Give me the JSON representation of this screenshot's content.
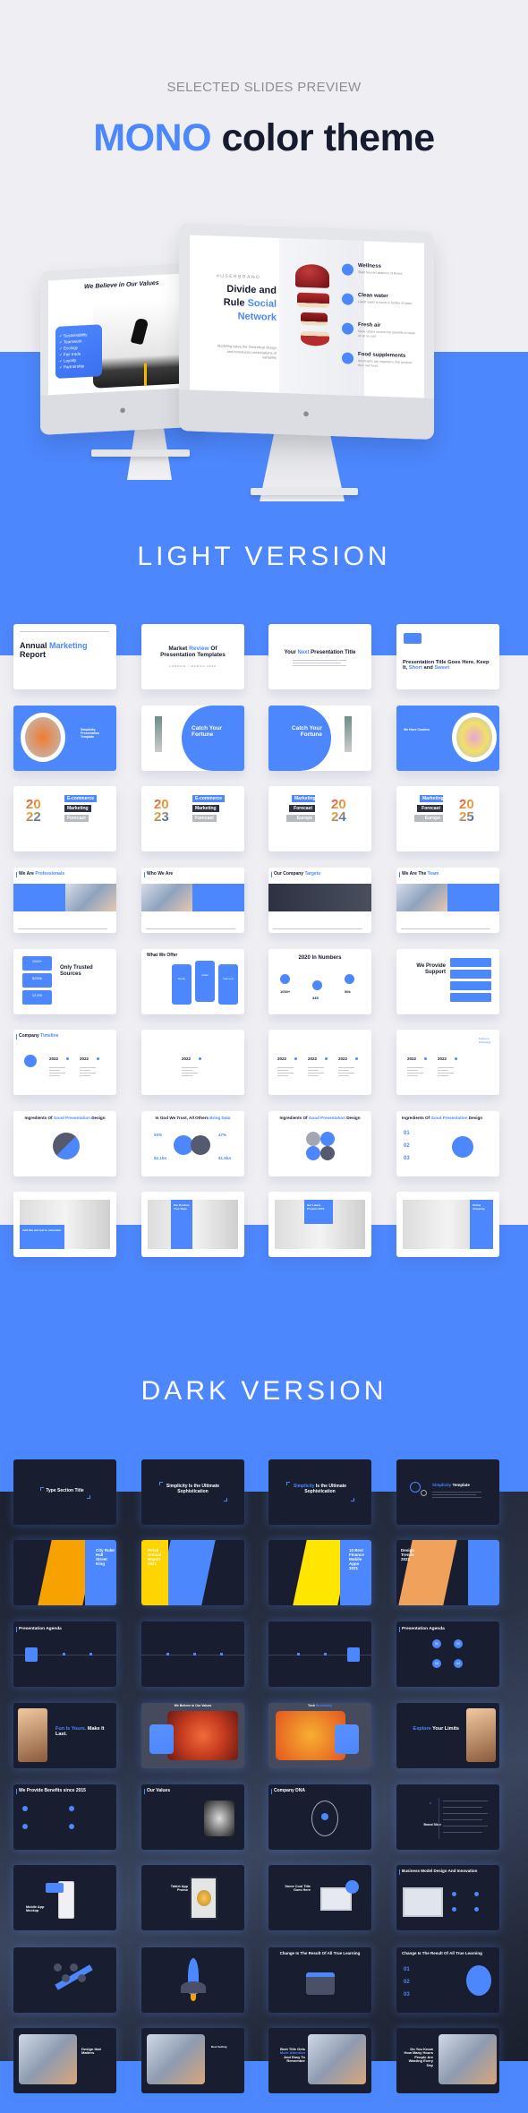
{
  "header": {
    "eyebrow": "SELECTED SLIDES PREVIEW",
    "title_accent": "MONO",
    "title_rest": " color theme"
  },
  "colors": {
    "accent": "#4d87fd",
    "dark_text": "#161b2f",
    "light_bg": "#efeff3",
    "dark_slide_bg": "#181d2f"
  },
  "monitors": {
    "left_screen": {
      "title": "We Believe in Our Values",
      "list": [
        "Sustainability",
        "Teamwork",
        "Ecology",
        "Fair trade",
        "Loyalty",
        "Partnership"
      ]
    },
    "right_screen": {
      "eyebrow": "#USERBRAND",
      "title_line1": "Divide and",
      "title_line2": "Rule ",
      "title_accent1": "Social",
      "title_accent2": "Network",
      "body": "Modeling takes the theoretical design and introduces combinations of variables",
      "features": [
        {
          "title": "Wellness",
          "text": "State beyond absence of illness",
          "icon": "heart-icon"
        },
        {
          "title": "Clean water",
          "text": "Liquid water is found in bodies of water",
          "icon": "water-drop-icon"
        },
        {
          "title": "Fresh air",
          "text": "Many others receive the benefits of clean air at no cost",
          "icon": "air-icon"
        },
        {
          "title": "Food supplements",
          "text": "Autotrophs are organisms that produce their own food",
          "icon": "food-icon"
        }
      ]
    }
  },
  "light_section": {
    "title": "LIGHT VERSION",
    "slides": [
      {
        "pre": "Annual ",
        "acc": "Marketing",
        "post": " Report"
      },
      {
        "pre": "Market ",
        "acc": "Review",
        "post": " Of Presentation Templates",
        "sub": "LONDON / MARCH 2020"
      },
      {
        "pre": "Your ",
        "acc": "Next",
        "post": " Presentation Title"
      },
      {
        "pre": "Presentation Title Goes Here. Keep It, ",
        "acc": "Short",
        "mid": " and ",
        "acc2": "Sweet"
      },
      {
        "pre": "Simplicity Presentation Template"
      },
      {
        "pre": "Catch Your Fortune"
      },
      {
        "pre": "Catch Your Fortune"
      },
      {
        "pre": "We Have Cookies"
      },
      {
        "year": "2022",
        "tags": [
          "E-commerce",
          "Marketing",
          "Forecast"
        ]
      },
      {
        "year": "2023",
        "tags": [
          "E-commerce",
          "Marketing",
          "Forecast"
        ]
      },
      {
        "year": "2024",
        "tags": [
          "Marketing",
          "Forecast",
          "Europe"
        ]
      },
      {
        "year": "2025",
        "tags": [
          "Marketing",
          "Forecast",
          "Europe"
        ]
      },
      {
        "pre": "We Are ",
        "acc": "Professionals"
      },
      {
        "pre": "Who We Are"
      },
      {
        "pre": "Our Company ",
        "acc": "Targets"
      },
      {
        "pre": "We Are The ",
        "acc": "Team"
      },
      {
        "pre": "Only Trusted Sources",
        "stats": [
          "1000+",
          "$250k",
          "12,5%"
        ]
      },
      {
        "pre": "What We Offer",
        "cards": [
          "Identity",
          "Global",
          "Clean Line"
        ]
      },
      {
        "pre": "2020 In Numbers",
        "stats": [
          "1000+",
          "345",
          "50k"
        ]
      },
      {
        "pre": "We Provide Support"
      },
      {
        "pre": "Company ",
        "acc": "Timeline",
        "years": [
          "2022",
          "2022"
        ]
      },
      {
        "years": [
          "2022"
        ]
      },
      {
        "years": [
          "2022",
          "2022",
          "2022"
        ]
      },
      {
        "years": [
          "2022",
          "2022"
        ],
        "note": "Future Is Promising"
      },
      {
        "pre": "Ingredients Of ",
        "acc": "Good Presentation",
        "post": " Design"
      },
      {
        "pre": "In God We Trust, All Others ",
        "acc": "Bring Data",
        "stats": [
          "53%",
          "47%",
          "$2.1bn",
          "$1.5bn"
        ]
      },
      {
        "pre": "Ingredients Of ",
        "acc": "Good Presentation",
        "post": " Design"
      },
      {
        "pre": "Ingredients Of ",
        "acc": "Good Presentation",
        "post": " Design",
        "nums": [
          "01",
          "02",
          "03"
        ]
      },
      {
        "pre": "Add title and text to remember"
      },
      {
        "pre": "Our Product Your Style"
      },
      {
        "pre": "Our Latest Projects 2019"
      },
      {
        "pre": "Online shopping"
      }
    ]
  },
  "dark_section": {
    "title": "DARK VERSION",
    "slides": [
      {
        "pre": "Type Section Title"
      },
      {
        "pre": "Simplicity Is the Ultimate Sophistication"
      },
      {
        "acc": "Simplicity",
        "post": " Is the Ultimate Sophistication"
      },
      {
        "acc": "Simplicity",
        "post": " Template"
      },
      {
        "pre": "City Ruler Hall Street King"
      },
      {
        "pre": "Retail Annual Report 2021"
      },
      {
        "pre": "10 Best Finance Mobile Apps 2021"
      },
      {
        "pre": "Design Trends 2022"
      },
      {
        "pre": "Presentation Agenda"
      },
      {
        "pre": ""
      },
      {
        "pre": ""
      },
      {
        "pre": "Presentation Agenda",
        "nums": [
          "01",
          "02",
          "03",
          "04"
        ]
      },
      {
        "acc": "Fun Is Yours.",
        "post": " Make It Last."
      },
      {
        "pre": "We Believe in Our Values"
      },
      {
        "pre": "Tech ",
        "acc": "Revolution"
      },
      {
        "acc": "Explore",
        "post": " Your Limits"
      },
      {
        "pre": "We Provide Benefits since 2015"
      },
      {
        "pre": "Our Values"
      },
      {
        "pre": "Company DNA"
      },
      {
        "pre": "Brand Slide"
      },
      {
        "pre": "Mobile App Mockup"
      },
      {
        "pre": "Tablet App Promo"
      },
      {
        "pre": "Some Cool Title Goes Here"
      },
      {
        "pre": "Business Model Design And Innovation"
      },
      {
        "pre": ""
      },
      {
        "pre": ""
      },
      {
        "pre": "Change Is The Result Of All True Learning"
      },
      {
        "pre": "Change Is The Result Of All True Learning",
        "nums": [
          "01",
          "02",
          "03"
        ]
      },
      {
        "pre": "Design that Matters"
      },
      {
        "pre": "Best Setting"
      },
      {
        "pre": "Best Title Gets ",
        "acc": "More Attention",
        "post": " And Easy To Remember"
      },
      {
        "pre": "Do You Know How Many Hours People Are Wasting Every Day"
      }
    ]
  }
}
